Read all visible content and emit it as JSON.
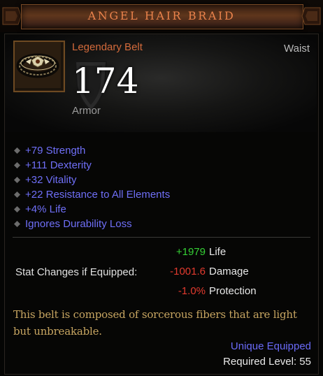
{
  "item": {
    "name": "ANGEL HAIR BRAID",
    "type": "Legendary Belt",
    "slot": "Waist",
    "armor_value": "174",
    "armor_label": "Armor",
    "icon": "belt-icon"
  },
  "affixes": [
    "+79 Strength",
    "+111 Dexterity",
    "+32 Vitality",
    "+22 Resistance to All Elements",
    "+4% Life",
    "Ignores Durability Loss"
  ],
  "stat_changes": {
    "label": "Stat Changes if Equipped:",
    "rows": [
      {
        "value": "+1979",
        "name": "Life",
        "color": "#35d035"
      },
      {
        "value": "-1001.6",
        "name": "Damage",
        "color": "#e23a2e"
      },
      {
        "value": "-1.0%",
        "name": "Protection",
        "color": "#e23a2e"
      }
    ]
  },
  "flavor_text": "This belt is composed of sorcerous fibers that are light but unbreakable.",
  "unique_equipped": "Unique Equipped",
  "required_level": "Required Level: 55",
  "colors": {
    "legendary": "#d36a3b",
    "magic_affix": "#6f6ff7",
    "flavor": "#c7a561"
  }
}
